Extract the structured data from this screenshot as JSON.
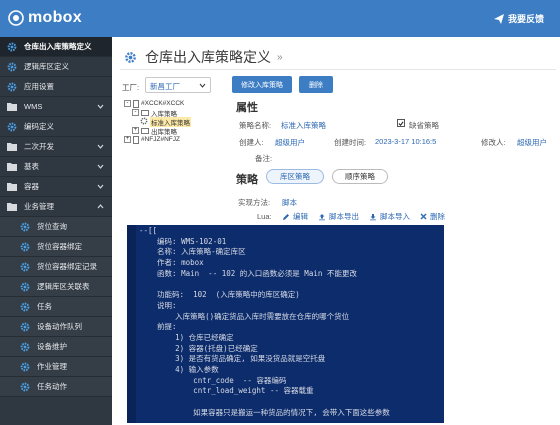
{
  "app": {
    "name": "mobox",
    "feedback": "我要反馈"
  },
  "sidebar": {
    "items": [
      {
        "label": "仓库出入库策略定义",
        "icon": "gear-icon",
        "active": true
      },
      {
        "label": "逻辑库区定义",
        "icon": "gear-icon"
      },
      {
        "label": "应用设置",
        "icon": "gear-icon"
      },
      {
        "label": "WMS",
        "icon": "folder-icon",
        "expandable": true
      },
      {
        "label": "编码定义",
        "icon": "gear-icon"
      },
      {
        "label": "二次开发",
        "icon": "folder-icon",
        "expandable": true
      },
      {
        "label": "基表",
        "icon": "folder-icon",
        "expandable": true
      },
      {
        "label": "容器",
        "icon": "folder-icon",
        "expandable": true
      },
      {
        "label": "业务管理",
        "icon": "folder-icon",
        "expandable": true,
        "expanded": true
      }
    ],
    "subitems": [
      {
        "label": "货位查询"
      },
      {
        "label": "货位容器绑定"
      },
      {
        "label": "货位容器绑定记录"
      },
      {
        "label": "逻辑库区关联表"
      },
      {
        "label": "任务"
      },
      {
        "label": "设备动作队列"
      },
      {
        "label": "设备维护"
      },
      {
        "label": "作业管理"
      },
      {
        "label": "任务动作"
      }
    ]
  },
  "page": {
    "title": "仓库出入库策略定义",
    "arrow": "»"
  },
  "factory": {
    "label": "工厂:",
    "value": "新昌工厂"
  },
  "tree": [
    {
      "label": "#XCCK#XCCK",
      "level": 0,
      "toggle": "-"
    },
    {
      "label": "入库策略",
      "level": 1,
      "toggle": "-"
    },
    {
      "label": "标准入库策略",
      "level": 2,
      "selected": true
    },
    {
      "label": "出库策略",
      "level": 1,
      "toggle": "+"
    },
    {
      "label": "#NFJZ#NFJZ",
      "level": 0,
      "toggle": "+"
    }
  ],
  "actions": {
    "edit": "修改入库策略",
    "delete": "删除"
  },
  "properties": {
    "title": "属性",
    "name_label": "策略名称:",
    "name_value": "标准入库策略",
    "default_label": "缺省策略",
    "default_checked": true,
    "creator_label": "创建人:",
    "creator_value": "超级用户",
    "created_label": "创建时间:",
    "created_value": "2023-3-17 10:16:5",
    "modifier_label": "修改人:",
    "modifier_value": "超级用户",
    "remark_label": "备注:"
  },
  "strategy": {
    "title": "策略",
    "tabs": [
      "库区策略",
      "顺序策略"
    ],
    "impl_label": "实现方法:",
    "impl_value": "脚本",
    "lua_label": "Lua:",
    "tools": [
      "编辑",
      "脚本导出",
      "脚本导入",
      "删除"
    ]
  },
  "code_lines": [
    "--[[",
    "    编码: WMS-102-01",
    "    名称: 入库策略-确定库区",
    "    作者: mobox",
    "    函数: Main  -- 102 的入口函数必须是 Main 不能更改",
    "",
    "    功能码:  102  (入库策略中的库区确定)",
    "    说明:",
    "        入库策略()确定货品入库时需要放在仓库的哪个货位",
    "    前提:",
    "        1) 仓库已经确定",
    "        2) 容器(托盘)已经确定",
    "        3) 是否有货品确定, 如果没货品就是空托盘",
    "        4) 输入参数",
    "            cntr_code  -- 容器编码",
    "            cntr_load_weight -- 容器载重",
    "",
    "            如果容器只是搬运一种货品的情况下, 会带入下面这些参数"
  ]
}
